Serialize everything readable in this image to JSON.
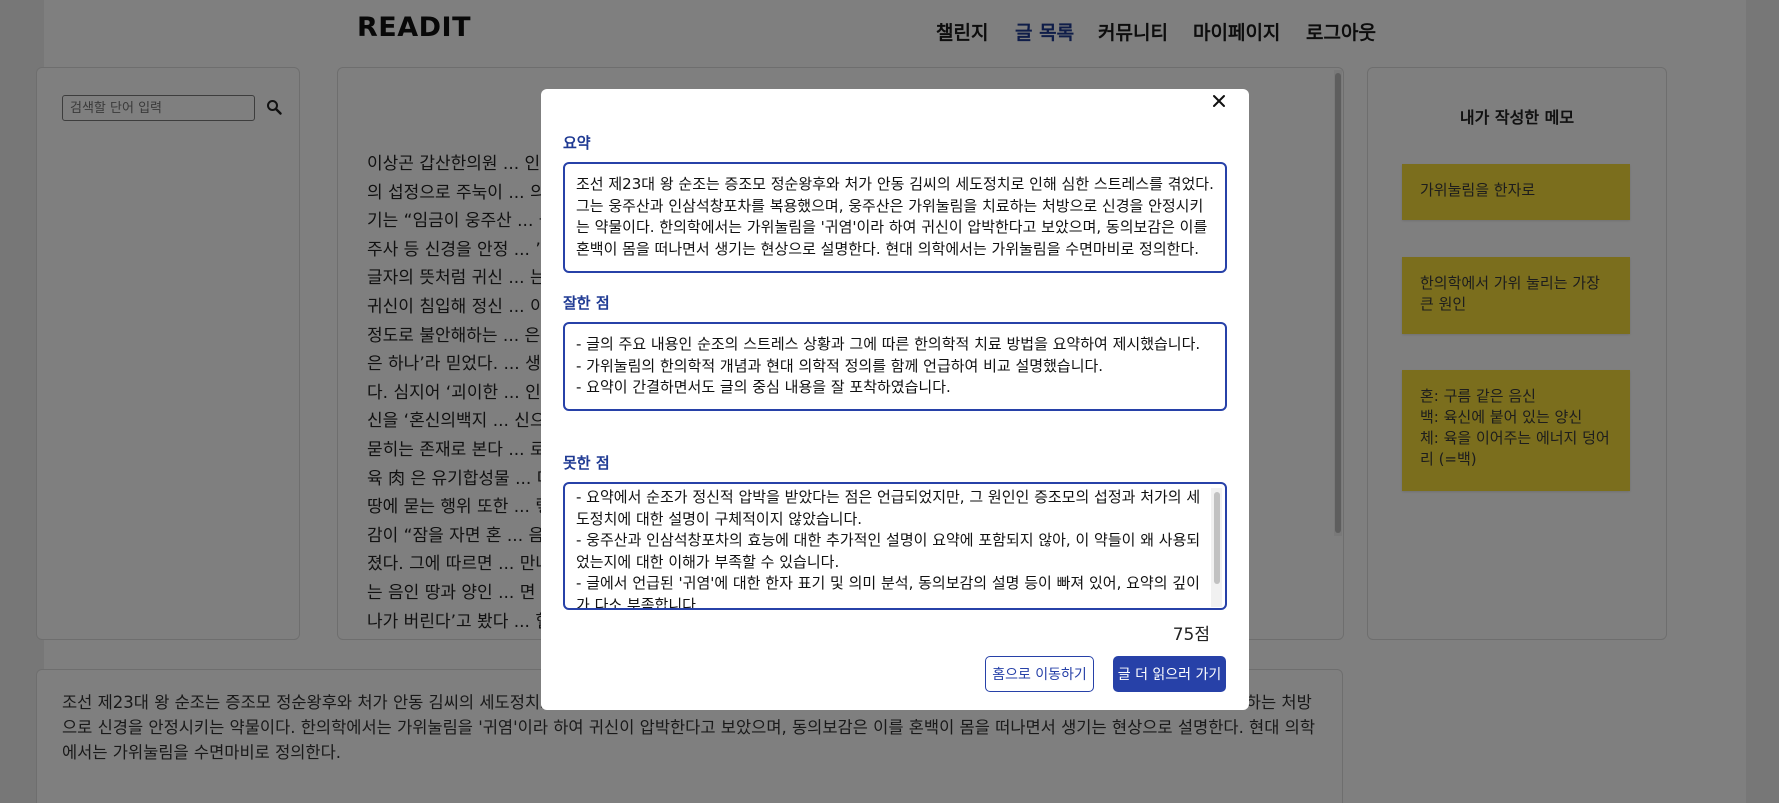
{
  "header": {
    "logo": "READIT",
    "nav": [
      {
        "label": "챌린지",
        "active": false
      },
      {
        "label": "글 목록",
        "active": true
      },
      {
        "label": "커뮤니티",
        "active": false
      },
      {
        "label": "마이페이지",
        "active": false
      },
      {
        "label": "로그아웃",
        "active": false
      }
    ]
  },
  "search": {
    "placeholder": "검색할 단어 입력",
    "icon": "search-icon"
  },
  "article": {
    "lines": [
      "이상곤 갑산한의원 ... 인 정순왕후",
      "의 섭정으로 주눅이 ... 의 승정원일",
      "기는 “임금이 웅주산 ... 물은 우황 웅황",
      "주사 등 신경을 안정 ... ’이라고 한다.",
      "글자의 뜻처럼 귀신 ... 는데 그 틈을 타",
      "귀신이 침입해 정신 ... 이런 꿈을 꿀",
      "정도로 불안해하는 ... 은 ‘삶과 죽음",
      "은 하나’라 믿었다. ... 생각에서 나왔",
      "다. 심지어 ‘괴이한 ... 인선 인간의 정",
      "신을 ‘혼신의백지 ... 신으로 땅에",
      "묻히는 존재로 본다 ... 로 이어져 있다.",
      "육 肉 은 유기합성물 ... 다. 죽은 자를",
      "땅에 묻는 행위 또한 ... 렇다면 동의보",
      "감이 “잠을 자면 혼 ... 음양관을 가",
      "졌다. 그에 따르면 ... 만나고 밤에",
      "는 음인 땅과 양인 ... 면 ‘몸 밖으로",
      "나가 버린다’고 봤다 ... 혈기 부족에"
    ]
  },
  "memo": {
    "title": "내가 작성한 메모",
    "items": [
      "가위눌림을 한자로",
      "한의학에서 가위 눌리는 가장 큰 원인",
      "혼: 구름 같은 음신\n백: 육신에 붙어 있는 양신\n체: 육을 이어주는 에너지 덩어리 (=백)"
    ],
    "color": "#f6dd3b"
  },
  "bottom_summary": "조선 제23대 왕 순조는 증조모 정순왕후와 처가 안동 김씨의 세도정치로 인해 심한 스트레스를 겪었다. 그는 웅주산과 인삼석창포차를 복용했으며, 웅주산은 가위눌림을 치료하는 처방으로 신경을 안정시키는 약물이다. 한의학에서는 가위눌림을 '귀염'이라 하여 귀신이 압박한다고 보았으며, 동의보감은 이를 혼백이 몸을 떠나면서 생기는 현상으로 설명한다. 현대 의학에서는 가위눌림을 수면마비로 정의한다.",
  "modal": {
    "close_icon": "close-icon",
    "summary_title": "요약",
    "summary_text": "조선 제23대 왕 순조는 증조모 정순왕후와 처가 안동 김씨의 세도정치로 인해 심한 스트레스를 겪었다. 그는 웅주산과 인삼석창포차를 복용했으며, 웅주산은 가위눌림을 치료하는 처방으로 신경을 안정시키는 약물이다. 한의학에서는 가위눌림을 '귀염'이라 하여 귀신이 압박한다고 보았으며, 동의보감은 이를 혼백이 몸을 떠나면서 생기는 현상으로 설명한다. 현대 의학에서는 가위눌림을 수면마비로 정의한다.",
    "good_title": "잘한 점",
    "good_text": "- 글의 주요 내용인 순조의 스트레스 상황과 그에 따른 한의학적 치료 방법을 요약하여 제시했습니다.\n- 가위눌림의 한의학적 개념과 현대 의학적 정의를 함께 언급하여 비교 설명했습니다.\n- 요약이 간결하면서도 글의 중심 내용을 잘 포착하였습니다.",
    "bad_title": "못한 점",
    "bad_text": "- 요약에서 순조가 정신적 압박을 받았다는 점은 언급되었지만, 그 원인인 증조모의 섭정과 처가의 세도정치에 대한 설명이 구체적이지 않았습니다.\n- 웅주산과 인삼석창포차의 효능에 대한 추가적인 설명이 요약에 포함되지 않아, 이 약들이 왜 사용되었는지에 대한 이해가 부족할 수 있습니다.\n- 글에서 언급된 '귀염'에 대한 한자 표기 및 의미 분석, 동의보감의 설명 등이 빠져 있어, 요약의 깊이가 다소 부족합니다.",
    "score": "75점",
    "home_button": "홈으로 이동하기",
    "read_more_button": "글 더 읽으러 가기"
  },
  "colors": {
    "accent": "#2741a8",
    "memo": "#f6dd3b"
  }
}
